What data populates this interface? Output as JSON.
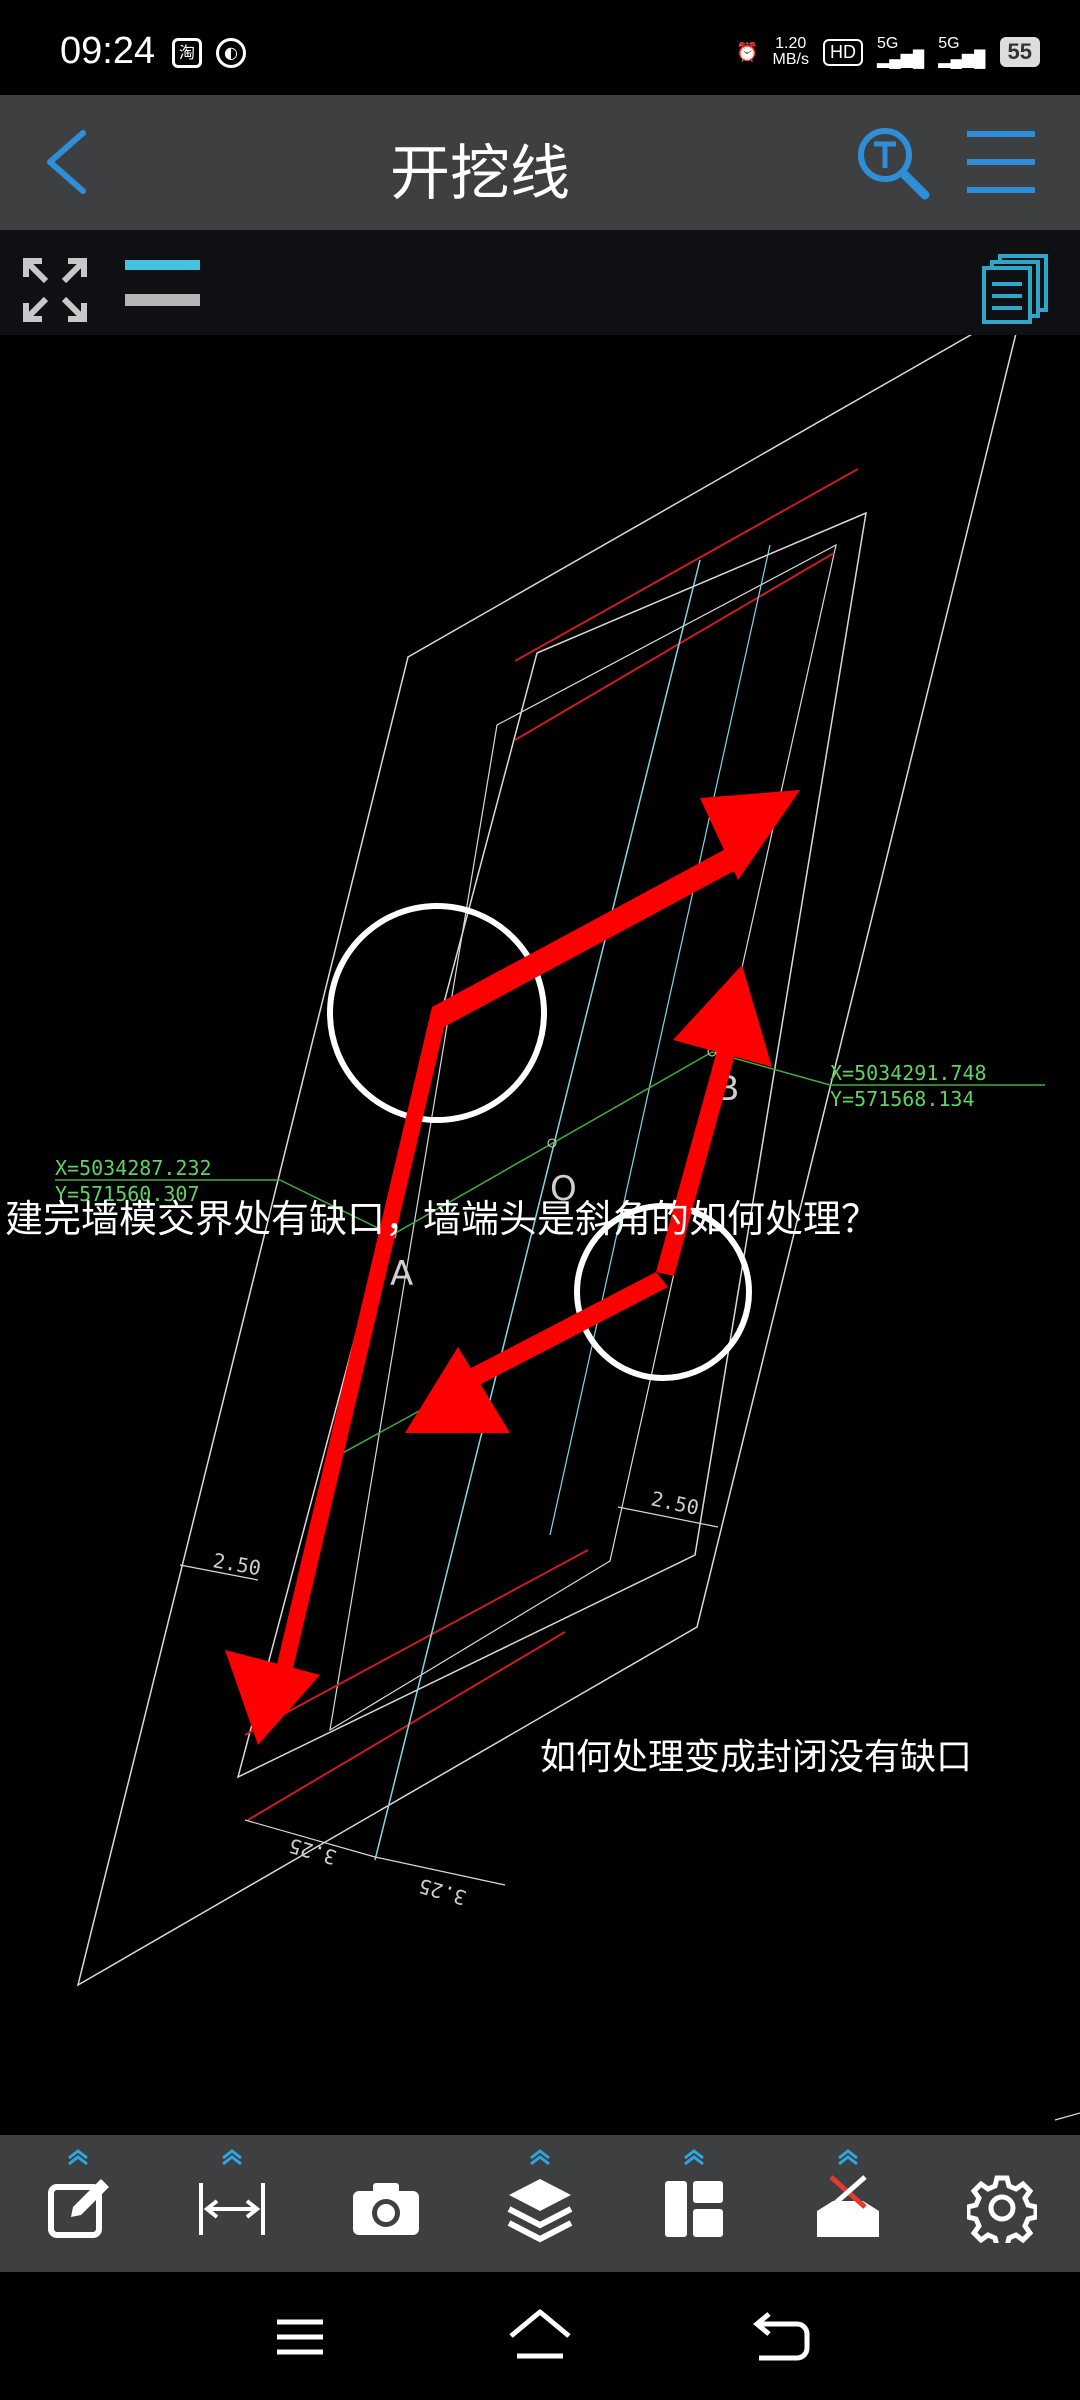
{
  "status_bar": {
    "time": "09:24",
    "net_speed_value": "1.20",
    "net_speed_unit": "MB/s",
    "hd_label": "HD",
    "signal_1": "5G",
    "signal_2": "5G",
    "battery": "55"
  },
  "app_bar": {
    "title": "开挖线",
    "back_icon": "chevron-left-icon",
    "search_icon": "text-search-icon",
    "menu_icon": "hamburger-menu-icon"
  },
  "sub_toolbar": {
    "expand_icon": "expand-arrows-icon",
    "layers_icon": "layer-lines-icon",
    "pages_icon": "stacked-pages-icon"
  },
  "drawing": {
    "question_main": "建完墙模交界处有缺口，墙端头是斜角的如何处理？",
    "question_secondary": "如何处理变成封闭没有缺口",
    "point_a": "A",
    "point_o": "O",
    "point_b": "B",
    "coord_left_x": "X=5034287.232",
    "coord_left_y": "Y=571560.307",
    "coord_right_x": "X=5034291.748",
    "coord_right_y": "Y=571568.134",
    "dim_left": "2.50",
    "dim_right": "2.50",
    "dim_bottom_1": "3.25",
    "dim_bottom_2": "3.25",
    "colors": {
      "outline": "#d9d9d9",
      "cyan_line": "#7fd8e6",
      "red_line": "#c81e1e",
      "green_line": "#3fae3f",
      "arrow": "#ff0000"
    }
  },
  "bottom_toolbar": {
    "tools": [
      "edit-icon",
      "measure-distance-icon",
      "camera-icon",
      "layers-icon",
      "layout-panels-icon",
      "toolbox-icon",
      "settings-gear-icon"
    ]
  },
  "nav_bar": {
    "menu_icon": "nav-menu-icon",
    "home_icon": "nav-home-icon",
    "back_icon": "nav-back-icon"
  }
}
